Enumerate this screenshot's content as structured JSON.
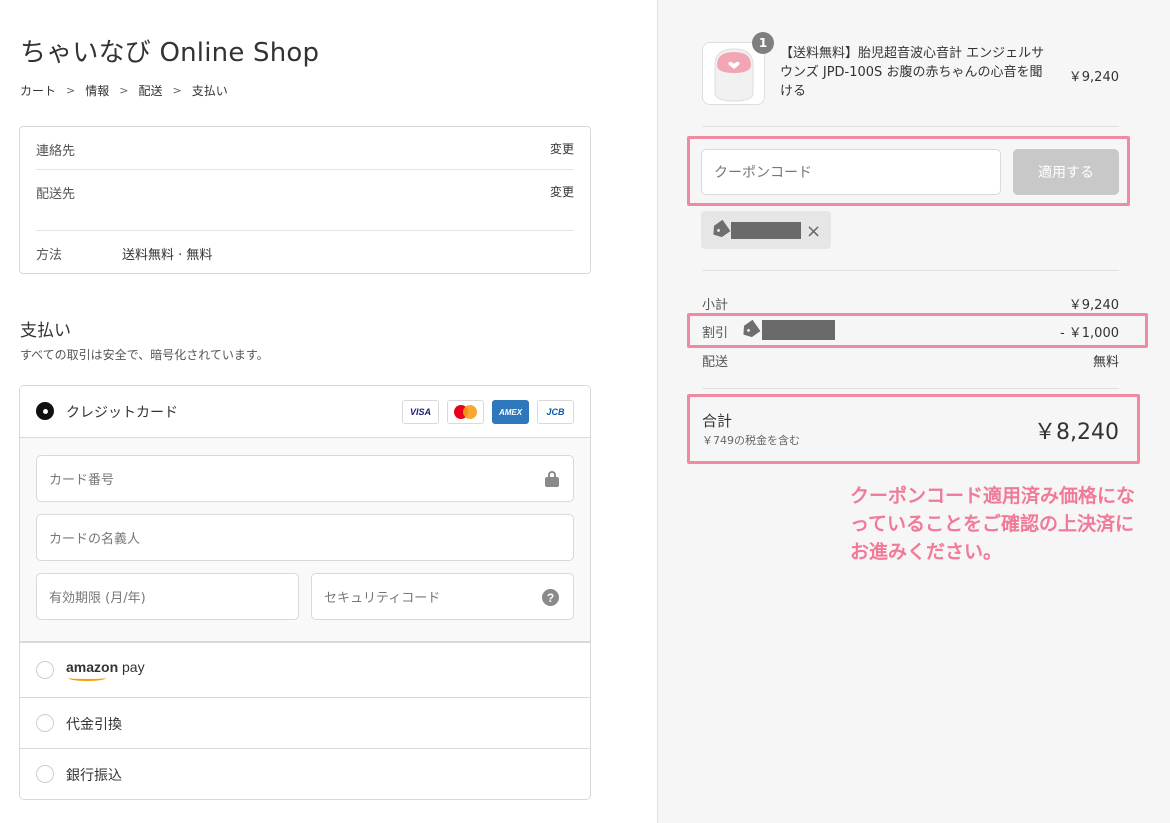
{
  "shop": {
    "title": "ちゃいなび Online Shop"
  },
  "breadcrumb": {
    "items": [
      "カート",
      "情報",
      "配送",
      "支払い"
    ]
  },
  "info": {
    "contact_label": "連絡先",
    "contact_change": "変更",
    "shipping_label": "配送先",
    "shipping_change": "変更",
    "method_label": "方法",
    "method_value": "送料無料 · 無料"
  },
  "payment": {
    "title": "支払い",
    "subtitle": "すべての取引は安全で、暗号化されています。",
    "credit_card_label": "クレジットカード",
    "card_brands": [
      "VISA",
      "MasterCard",
      "AMEX",
      "JCB"
    ],
    "fields": {
      "card_number": "カード番号",
      "card_name": "カードの名義人",
      "expiry": "有効期限 (月/年)",
      "security": "セキュリティコード"
    },
    "amazon_pay": {
      "word1": "amazon",
      "word2": "pay"
    },
    "cod_label": "代金引換",
    "bank_label": "銀行振込"
  },
  "order": {
    "quantity": "1",
    "product_name": "【送料無料】胎児超音波心音計 エンジェルサウンズ JPD-100S お腹の赤ちゃんの心音を聞ける",
    "product_price": "￥9,240",
    "coupon_placeholder": "クーポンコード",
    "apply_button": "適用する",
    "remove_icon": "×",
    "subtotal_label": "小計",
    "subtotal_value": "￥9,240",
    "discount_label": "割引",
    "discount_value": "- ￥1,000",
    "shipping_label": "配送",
    "shipping_value": "無料",
    "total_label": "合計",
    "tax_note": "￥749の税金を含む",
    "total_value": "￥8,240"
  },
  "annotation": {
    "note": "クーポンコード適用済み価格になっていることをご確認の上決済にお進みください。",
    "highlight_color": "#f08aa3"
  },
  "colors": {
    "note_text": "#f07a98",
    "right_bg": "#f6f6f6"
  }
}
